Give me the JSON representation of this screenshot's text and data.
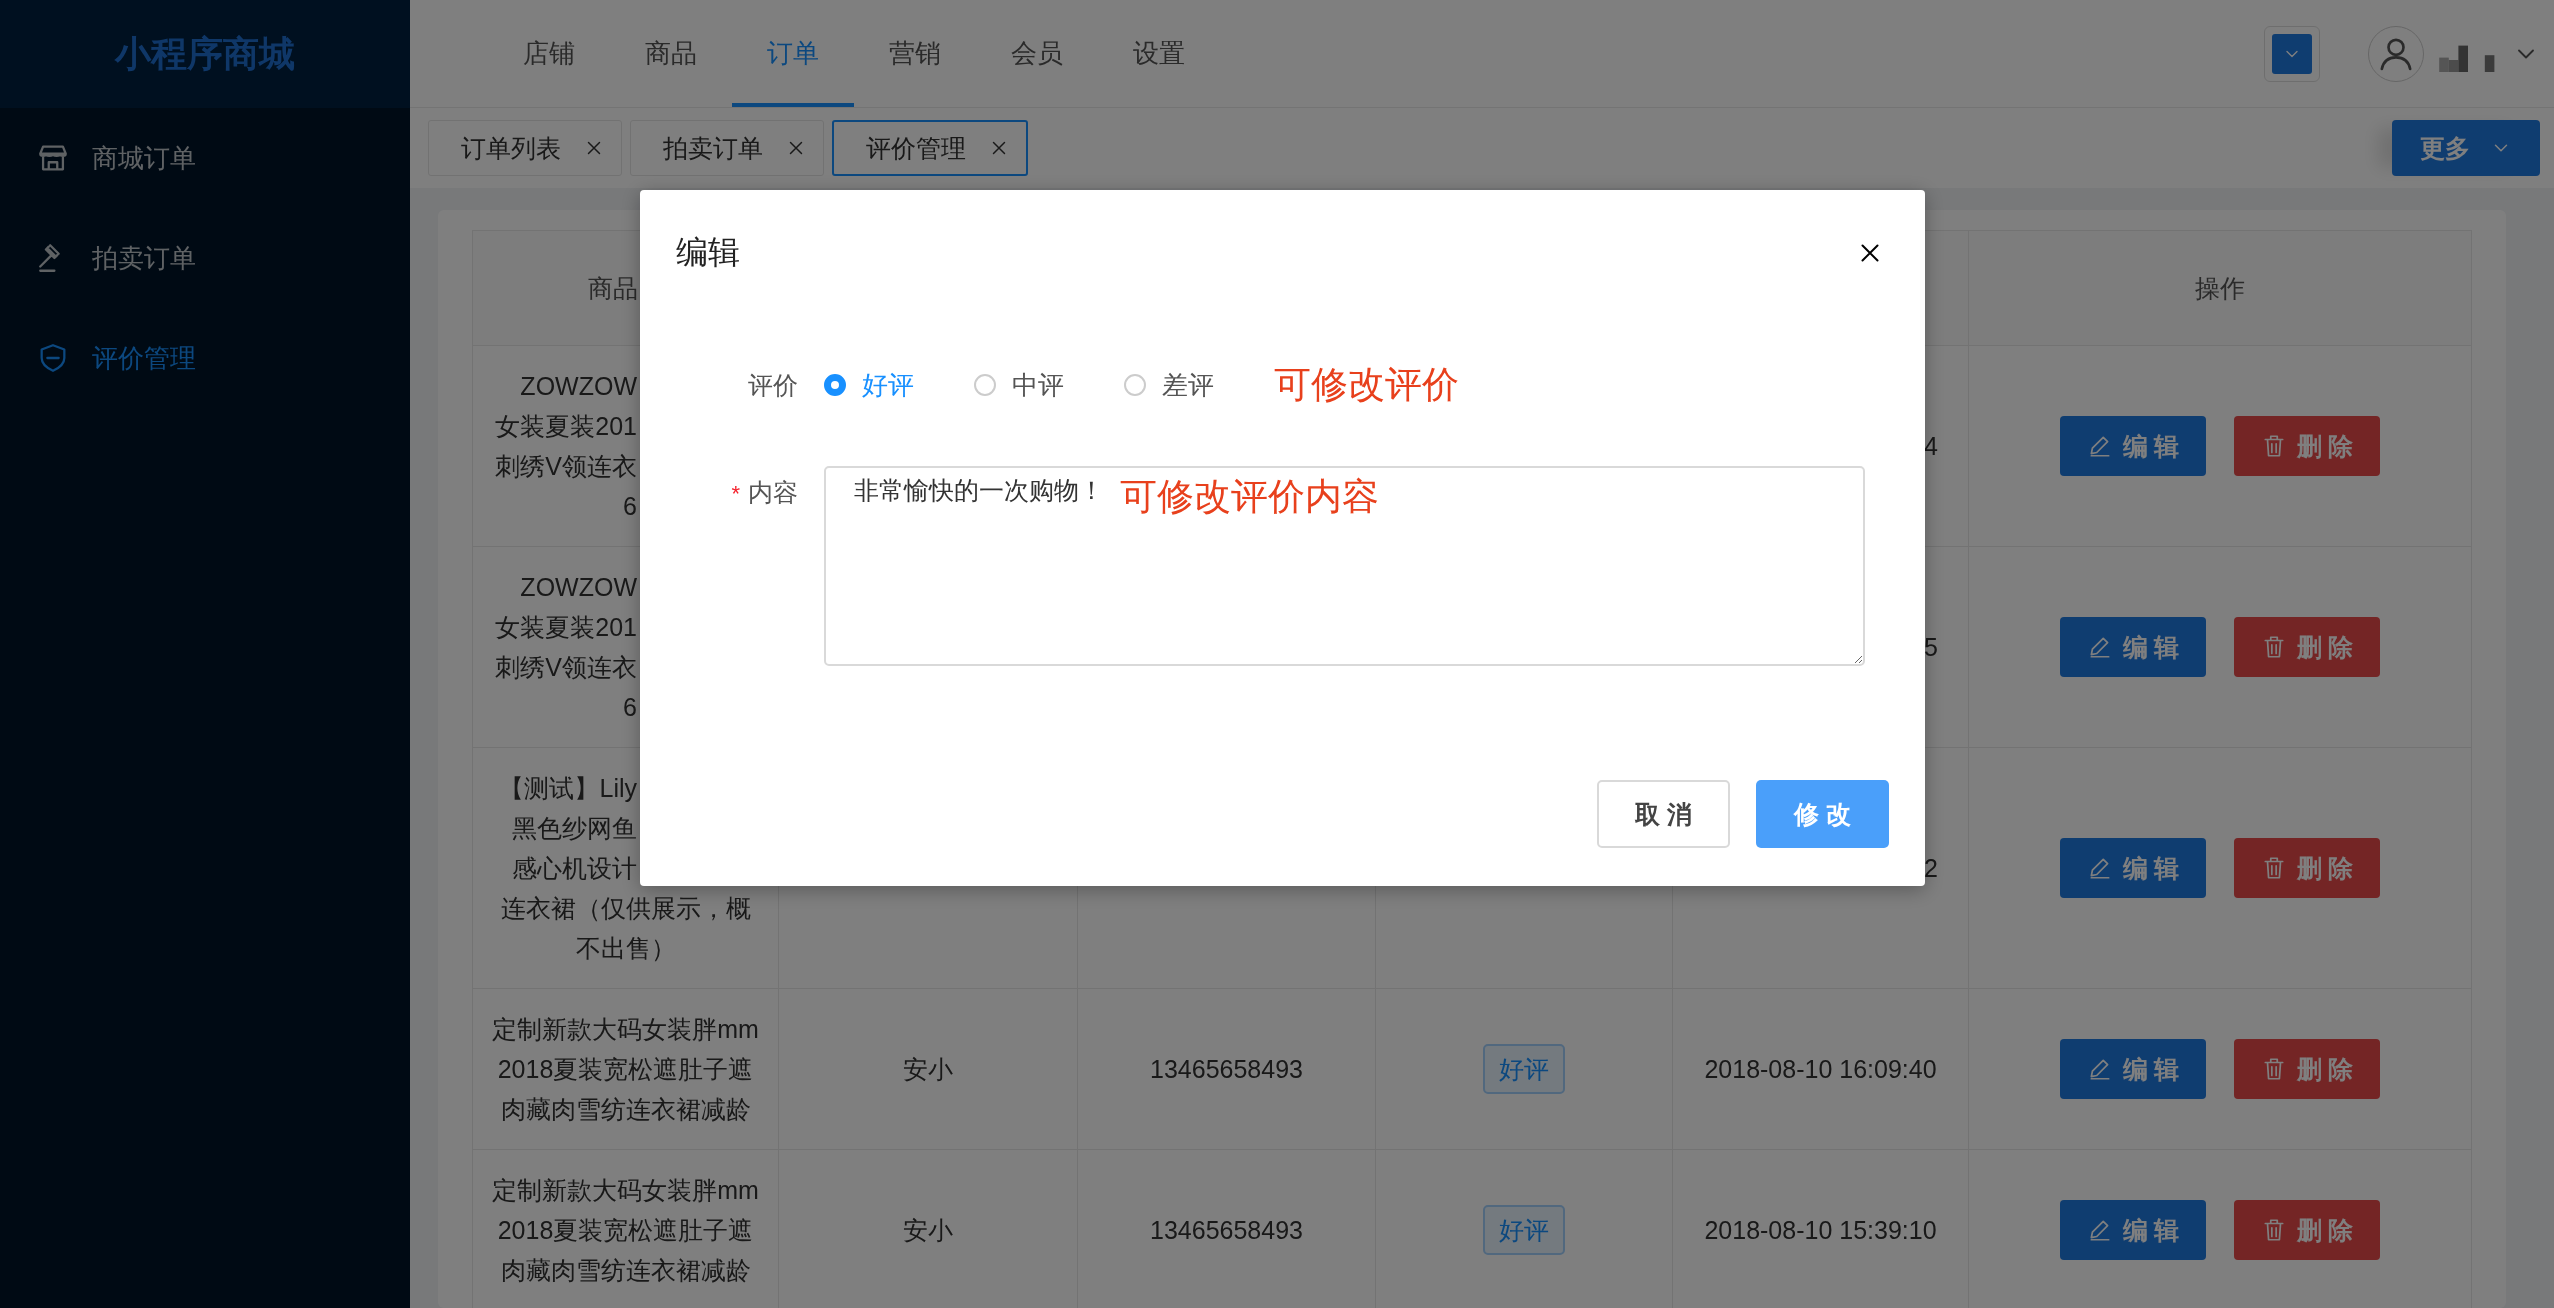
{
  "sidebar": {
    "logo": "小程序商城",
    "items": [
      {
        "label": "商城订单",
        "selected": false
      },
      {
        "label": "拍卖订单",
        "selected": false
      },
      {
        "label": "评价管理",
        "selected": true
      }
    ]
  },
  "top_nav": [
    {
      "label": "店铺",
      "selected": false
    },
    {
      "label": "商品",
      "selected": false
    },
    {
      "label": "订单",
      "selected": true
    },
    {
      "label": "营销",
      "selected": false
    },
    {
      "label": "会员",
      "selected": false
    },
    {
      "label": "设置",
      "selected": false
    }
  ],
  "open_tabs": [
    {
      "label": "订单列表",
      "selected": false
    },
    {
      "label": "拍卖订单",
      "selected": false
    },
    {
      "label": "评价管理",
      "selected": true
    }
  ],
  "more_button": "更多",
  "table": {
    "header": {
      "product": "商品",
      "actions": "操作"
    },
    "rows": [
      {
        "product_lines": [
          "ZOWZOW",
          "女装夏装201",
          "刺绣V领连衣",
          "6"
        ],
        "time": "4",
        "edit": "编 辑",
        "delete": "删 除"
      },
      {
        "product_lines": [
          "ZOWZOW",
          "女装夏装201",
          "刺绣V领连衣",
          "6"
        ],
        "time": "5",
        "edit": "编 辑",
        "delete": "删 除"
      },
      {
        "product_lines": [
          "【测试】Lily",
          "黑色纱网鱼",
          "感心机设计",
          "连衣裙（仅供展示，概",
          "不出售）"
        ],
        "time": "2",
        "edit": "编 辑",
        "delete": "删 除"
      },
      {
        "product_lines": [
          "定制新款大码女装胖mm",
          "2018夏装宽松遮肚子遮",
          "肉藏肉雪纺连衣裙减龄"
        ],
        "name": "安小",
        "phone": "13465658493",
        "rating": "好评",
        "time": "2018-08-10 16:09:40",
        "edit": "编 辑",
        "delete": "删 除"
      },
      {
        "product_lines": [
          "定制新款大码女装胖mm",
          "2018夏装宽松遮肚子遮",
          "肉藏肉雪纺连衣裙减龄"
        ],
        "name": "安小",
        "phone": "13465658493",
        "rating": "好评",
        "time": "2018-08-10 15:39:10",
        "edit": "编 辑",
        "delete": "删 除"
      }
    ]
  },
  "dialog": {
    "title": "编辑",
    "rating_label": "评价",
    "rating_options": [
      {
        "label": "好评",
        "selected": true
      },
      {
        "label": "中评",
        "selected": false
      },
      {
        "label": "差评",
        "selected": false
      }
    ],
    "rating_note": "可修改评价",
    "required_mark": "*",
    "content_label": "内容",
    "content_value": "非常愉快的一次购物！",
    "content_note": "可修改评价内容",
    "cancel": "取 消",
    "submit": "修 改"
  }
}
